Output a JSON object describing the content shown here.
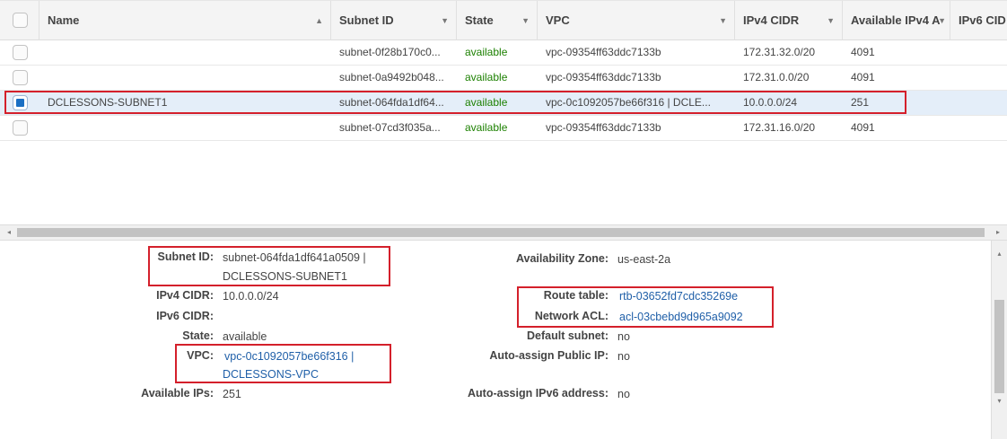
{
  "table": {
    "columns": [
      {
        "label": "Name",
        "sort": "▲"
      },
      {
        "label": "Subnet ID",
        "sort": "▼"
      },
      {
        "label": "State",
        "sort": "▼"
      },
      {
        "label": "VPC",
        "sort": "▼"
      },
      {
        "label": "IPv4 CIDR",
        "sort": "▼"
      },
      {
        "label": "Available IPv4 A",
        "sort": "▼"
      },
      {
        "label": "IPv6 CID",
        "sort": ""
      }
    ],
    "rows": [
      {
        "checked": false,
        "name": "",
        "subnet_id": "subnet-0f28b170c0...",
        "state": "available",
        "vpc": "vpc-09354ff63ddc7133b",
        "ipv4": "172.31.32.0/20",
        "avail": "4091"
      },
      {
        "checked": false,
        "name": "",
        "subnet_id": "subnet-0a9492b048...",
        "state": "available",
        "vpc": "vpc-09354ff63ddc7133b",
        "ipv4": "172.31.0.0/20",
        "avail": "4091"
      },
      {
        "checked": true,
        "name": "DCLESSONS-SUBNET1",
        "subnet_id": "subnet-064fda1df64...",
        "state": "available",
        "vpc": "vpc-0c1092057be66f316 | DCLE...",
        "ipv4": "10.0.0.0/24",
        "avail": "251"
      },
      {
        "checked": false,
        "name": "",
        "subnet_id": "subnet-07cd3f035a...",
        "state": "available",
        "vpc": "vpc-09354ff63ddc7133b",
        "ipv4": "172.31.16.0/20",
        "avail": "4091"
      }
    ]
  },
  "details": {
    "left": {
      "subnet_id_label": "Subnet ID:",
      "subnet_id_line1": "subnet-064fda1df641a0509 |",
      "subnet_id_line2": "DCLESSONS-SUBNET1",
      "ipv4_label": "IPv4 CIDR:",
      "ipv4_value": "10.0.0.0/24",
      "ipv6_label": "IPv6 CIDR:",
      "ipv6_value": "",
      "state_label": "State:",
      "state_value": "available",
      "vpc_label": "VPC:",
      "vpc_line1": "vpc-0c1092057be66f316 |",
      "vpc_line2": "DCLESSONS-VPC",
      "avail_label": "Available IPs:",
      "avail_value": "251"
    },
    "right": {
      "az_label": "Availability Zone:",
      "az_value": "us-east-2a",
      "route_label": "Route table:",
      "route_value": "rtb-03652fd7cdc35269e",
      "acl_label": "Network ACL:",
      "acl_value": "acl-03cbebd9d965a9092",
      "default_label": "Default subnet:",
      "default_value": "no",
      "autoip_label": "Auto-assign Public IP:",
      "autoip_value": "no",
      "autoipv6_label": "Auto-assign IPv6 address:",
      "autoipv6_value": "no"
    }
  },
  "icons": {
    "scroll_left": "◂",
    "scroll_right": "▸",
    "scroll_up": "▴",
    "scroll_down": "▾"
  },
  "colors": {
    "accent": "#1a6fc4",
    "highlight": "#d4202b",
    "status_green": "#1d8102",
    "link": "#1f5fa8"
  }
}
